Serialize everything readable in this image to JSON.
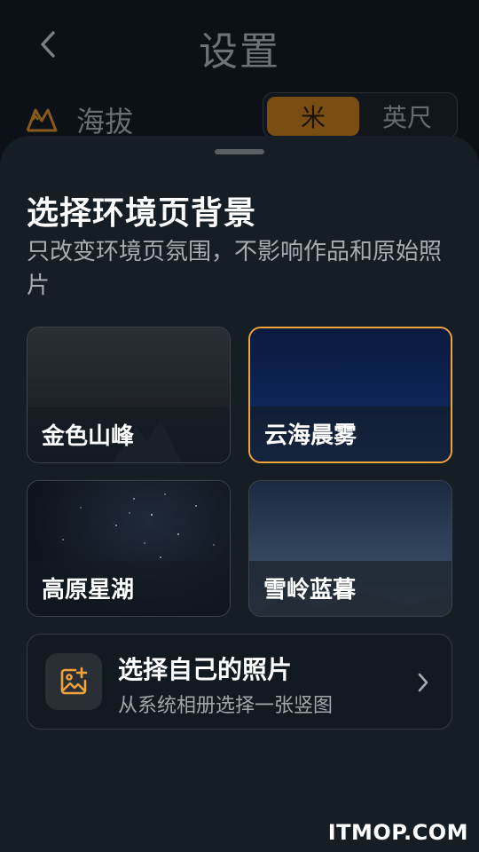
{
  "header": {
    "title": "设置",
    "back_icon": "chevron-left-icon"
  },
  "altitude": {
    "label": "海拔",
    "icon": "mountain-icon",
    "units": [
      {
        "label": "米",
        "selected": true
      },
      {
        "label": "英尺",
        "selected": false
      }
    ]
  },
  "sheet": {
    "title": "选择环境页背景",
    "description": "只改变环境页氛围，不影响作品和原始照片",
    "backgrounds": [
      {
        "label": "金色山峰",
        "selected": false
      },
      {
        "label": "云海晨雾",
        "selected": true
      },
      {
        "label": "高原星湖",
        "selected": false
      },
      {
        "label": "雪岭蓝暮",
        "selected": false
      }
    ],
    "own_photo": {
      "title": "选择自己的照片",
      "subtitle": "从系统相册选择一张竖图",
      "icon": "add-photo-icon"
    }
  },
  "colors": {
    "accent": "#f2a33a",
    "sheet_bg": "#151d25",
    "page_bg": "#0c1117"
  },
  "watermark": "ITMOP.COM"
}
